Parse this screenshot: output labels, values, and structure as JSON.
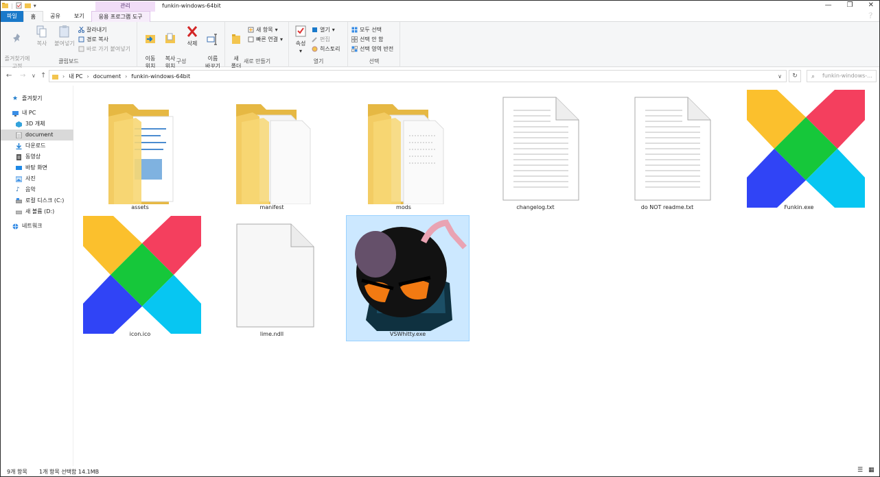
{
  "window": {
    "title": "funkin-windows-64bit",
    "context_group": "관리"
  },
  "ribbon_tabs": [
    {
      "label": "파일"
    },
    {
      "label": "홈"
    },
    {
      "label": "공유"
    },
    {
      "label": "보기"
    },
    {
      "label": "응용 프로그램 도구"
    }
  ],
  "ribbon": {
    "clipboard": {
      "pin_label": "즐겨찾기에\n고정",
      "copy_label": "복사",
      "paste_label": "붙여넣기",
      "cut_label": "잘라내기",
      "copy_path_label": "경로 복사",
      "paste_shortcut_label": "바로 가기 붙여넣기",
      "group_label": "클립보드"
    },
    "organize": {
      "move_label": "이동\n위치",
      "copyto_label": "복사\n위치",
      "delete_label": "삭제",
      "rename_label": "이름\n바꾸기",
      "group_label": "구성"
    },
    "new": {
      "newfolder_label": "새\n폴더",
      "newitem_label": "새 항목",
      "easyaccess_label": "빠른 연결",
      "group_label": "새로 만들기"
    },
    "open": {
      "properties_label": "속성",
      "open_label": "열기",
      "edit_label": "편집",
      "history_label": "히스토리",
      "group_label": "열기"
    },
    "select": {
      "selectall_label": "모두 선택",
      "selectnone_label": "선택 안 함",
      "invert_label": "선택 영역 반전",
      "group_label": "선택"
    }
  },
  "address": {
    "crumbs": [
      "내 PC",
      "document",
      "funkin-windows-64bit"
    ],
    "search_placeholder": "funkin-windows-..."
  },
  "navpane": [
    {
      "label": "즐겨찾기",
      "icon": "star-icon",
      "color": "#1979ca"
    },
    {
      "label": "내 PC",
      "icon": "computer-icon",
      "color": "#3a8ee6"
    },
    {
      "label": "3D 개체",
      "icon": "cube-icon",
      "color": "#33a3dc"
    },
    {
      "label": "document",
      "icon": "document-icon",
      "color": "#8a8a8a",
      "selected": true
    },
    {
      "label": "다운로드",
      "icon": "download-icon",
      "color": "#1e7fd4"
    },
    {
      "label": "동영상",
      "icon": "video-icon",
      "color": "#555555"
    },
    {
      "label": "바탕 화면",
      "icon": "desktop-icon",
      "color": "#1e88e5"
    },
    {
      "label": "사진",
      "icon": "picture-icon",
      "color": "#3a8ee6"
    },
    {
      "label": "음악",
      "icon": "music-icon",
      "color": "#2a6fb0"
    },
    {
      "label": "로컬 디스크 (C:)",
      "icon": "drive-icon",
      "color": "#777777"
    },
    {
      "label": "새 볼륨 (D:)",
      "icon": "drive-icon",
      "color": "#888888"
    },
    {
      "label": "네트워크",
      "icon": "network-icon",
      "color": "#3a8ee6"
    }
  ],
  "files": [
    {
      "name": "assets",
      "type": "folder"
    },
    {
      "name": "manifest",
      "type": "folder"
    },
    {
      "name": "mods",
      "type": "folder"
    },
    {
      "name": "changelog.txt",
      "type": "text"
    },
    {
      "name": "do NOT readme.txt",
      "type": "text"
    },
    {
      "name": "Funkin.exe",
      "type": "haxe"
    },
    {
      "name": "icon.ico",
      "type": "haxe"
    },
    {
      "name": "lime.ndll",
      "type": "blank"
    },
    {
      "name": "VSWhitty.exe",
      "type": "whitty",
      "selected": true
    }
  ],
  "status": {
    "count": "9개 항목",
    "selection": "1개 항목 선택함 14.1MB"
  },
  "colors": {
    "accent": "#1979ca",
    "selection_bg": "#cce8ff",
    "folder": "#f3cc63"
  }
}
